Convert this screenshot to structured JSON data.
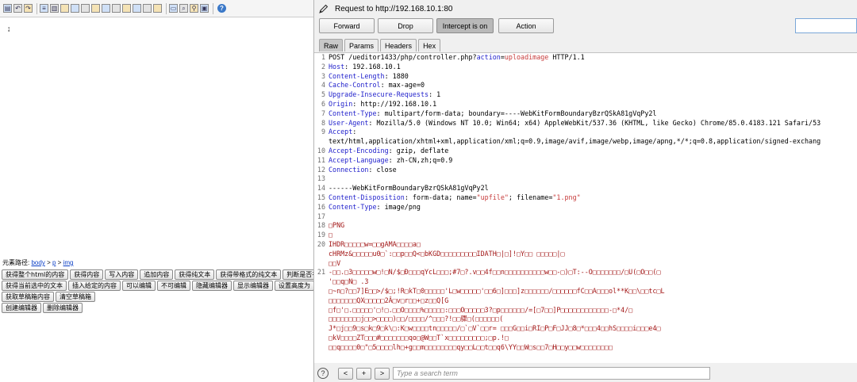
{
  "editor_toolbar": {
    "icons": [
      "source-icon",
      "undo-icon",
      "redo-icon",
      "format-icon",
      "paste-icon",
      "table-icon",
      "insert-table-icon",
      "delete-table-icon",
      "row-insert-icon",
      "row-delete-icon",
      "col-insert-icon",
      "col-delete-icon",
      "merge-cells-icon",
      "split-cells-icon",
      "insert-paragraph-icon",
      "print-icon",
      "preview-icon",
      "search-replace-icon",
      "drafts-icon",
      "help-icon"
    ]
  },
  "element_path": {
    "label": "元素路径:",
    "items": [
      "body",
      "p",
      "img"
    ],
    "separator": ">"
  },
  "editor_buttons": {
    "row1": [
      "获得整个html的内容",
      "获得内容",
      "写入内容",
      "追加内容",
      "获得纯文本",
      "获得带格式的纯文本",
      "判断是否有"
    ],
    "row2": [
      "获得当前选中的文本",
      "插入给定的内容",
      "可以编辑",
      "不可编辑",
      "隐藏编辑器",
      "显示编辑器",
      "设置高度为"
    ],
    "row3": [
      "获取草稿箱内容",
      "清空草稿箱"
    ],
    "row4": [
      "创建编辑器",
      "删除编辑器"
    ]
  },
  "burp": {
    "request_label": "Request to http://192.168.10.1:80",
    "buttons": {
      "forward": "Forward",
      "drop": "Drop",
      "intercept": "Intercept is on",
      "action": "Action"
    },
    "tabs": [
      "Raw",
      "Params",
      "Headers",
      "Hex"
    ],
    "active_tab": "Raw",
    "search_placeholder": "Type a search term",
    "nav": {
      "prev": "<",
      "add": "+",
      "next": ">"
    },
    "help": "?"
  },
  "request_lines": [
    {
      "n": "1",
      "parts": [
        {
          "t": "POST /ueditor1433/php/controller.php?",
          "c": "v"
        },
        {
          "t": "action",
          "c": "k"
        },
        {
          "t": "=",
          "c": "v"
        },
        {
          "t": "uploadimage",
          "c": "p"
        },
        {
          "t": " HTTP/1.1",
          "c": "v"
        }
      ]
    },
    {
      "n": "2",
      "parts": [
        {
          "t": "Host",
          "c": "k"
        },
        {
          "t": ": 192.168.10.1",
          "c": "v"
        }
      ]
    },
    {
      "n": "3",
      "parts": [
        {
          "t": "Content-Length",
          "c": "k"
        },
        {
          "t": ": 1880",
          "c": "v"
        }
      ]
    },
    {
      "n": "4",
      "parts": [
        {
          "t": "Cache-Control",
          "c": "k"
        },
        {
          "t": ": max-age=0",
          "c": "v"
        }
      ]
    },
    {
      "n": "5",
      "parts": [
        {
          "t": "Upgrade-Insecure-Requests",
          "c": "k"
        },
        {
          "t": ": 1",
          "c": "v"
        }
      ]
    },
    {
      "n": "6",
      "parts": [
        {
          "t": "Origin",
          "c": "k"
        },
        {
          "t": ": http://192.168.10.1",
          "c": "v"
        }
      ]
    },
    {
      "n": "7",
      "parts": [
        {
          "t": "Content-Type",
          "c": "k"
        },
        {
          "t": ": multipart/form-data; boundary=----WebKitFormBoundaryBzrQSkA81gVqPy2l",
          "c": "v"
        }
      ]
    },
    {
      "n": "8",
      "parts": [
        {
          "t": "User-Agent",
          "c": "k"
        },
        {
          "t": ": Mozilla/5.0 (Windows NT 10.0; Win64; x64) AppleWebKit/537.36 (KHTML, like Gecko) Chrome/85.0.4183.121 Safari/53",
          "c": "v"
        }
      ]
    },
    {
      "n": "9",
      "parts": [
        {
          "t": "Accept",
          "c": "k"
        },
        {
          "t": ":",
          "c": "v"
        }
      ]
    },
    {
      "n": "",
      "parts": [
        {
          "t": "text/html,application/xhtml+xml,application/xml;q=0.9,image/avif,image/webp,image/apng,*/*;q=0.8,application/signed-exchang",
          "c": "v"
        }
      ]
    },
    {
      "n": "10",
      "parts": [
        {
          "t": "Accept-Encoding",
          "c": "k"
        },
        {
          "t": ": gzip, deflate",
          "c": "v"
        }
      ]
    },
    {
      "n": "11",
      "parts": [
        {
          "t": "Accept-Language",
          "c": "k"
        },
        {
          "t": ": zh-CN,zh;q=0.9",
          "c": "v"
        }
      ]
    },
    {
      "n": "12",
      "parts": [
        {
          "t": "Connection",
          "c": "k"
        },
        {
          "t": ": close",
          "c": "v"
        }
      ]
    },
    {
      "n": "13",
      "parts": [
        {
          "t": "",
          "c": "v"
        }
      ]
    },
    {
      "n": "14",
      "parts": [
        {
          "t": "------WebKitFormBoundaryBzrQSkA81gVqPy2l",
          "c": "v"
        }
      ]
    },
    {
      "n": "15",
      "parts": [
        {
          "t": "Content-Disposition",
          "c": "k"
        },
        {
          "t": ": form-data; name=",
          "c": "v"
        },
        {
          "t": "\"upfile\"",
          "c": "p"
        },
        {
          "t": "; filename=",
          "c": "v"
        },
        {
          "t": "\"1.png\"",
          "c": "p"
        }
      ]
    },
    {
      "n": "16",
      "parts": [
        {
          "t": "Content-Type",
          "c": "k"
        },
        {
          "t": ": image/png",
          "c": "v"
        }
      ]
    },
    {
      "n": "17",
      "parts": [
        {
          "t": "",
          "c": "v"
        }
      ]
    },
    {
      "n": "18",
      "parts": [
        {
          "t": "□PNG",
          "c": "bin"
        }
      ]
    },
    {
      "n": "19",
      "parts": [
        {
          "t": "□",
          "c": "bin"
        }
      ]
    },
    {
      "n": "20",
      "parts": [
        {
          "t": "IHDR□□□□□w=□□gAMA□□□□a□",
          "c": "bin"
        }
      ]
    },
    {
      "n": "",
      "parts": [
        {
          "t": "cHRMz&□□□□□u0□`:□□p□□Q<□bKGD□□□□□□□□□IDATH□|□]!□Y□□ □□□□□|□",
          "c": "bin"
        }
      ]
    },
    {
      "n": "",
      "parts": [
        {
          "t": "□□V",
          "c": "bin"
        }
      ]
    },
    {
      "n": "21",
      "parts": [
        {
          "t": "-□□.□3□□□□□w□!□N/$□Ð□□□qYcL□□□;#7□?.v□□4f□□n□□□□□□□□□□w□□-□)□T:--O□□□□□□□/□U(□O□□(□",
          "c": "bin"
        }
      ]
    },
    {
      "n": "",
      "parts": [
        {
          "t": "'□□q□N□ .3",
          "c": "bin"
        }
      ]
    },
    {
      "n": "",
      "parts": [
        {
          "t": "□~n□?□□7]E□□>/$□;!R□kT□0□□□□□'L□w□□□□□'□□6□]□□□]z□□□□□□/□□□□□□fC□□A□□□ol**K□□\\□□tc□L",
          "c": "bin"
        }
      ]
    },
    {
      "n": "",
      "parts": [
        {
          "t": "□□□□□□□QX□□□□□2Â□v□r□□+□z□□Q[G",
          "c": "bin"
        }
      ]
    },
    {
      "n": "",
      "parts": [
        {
          "t": "□f□'□.□□□□□'□!□.□□O□□□□%□□□□□:□□□O□□□□□3?□p□□□□□□/=[□7□□]P□□□□□□□□□□□□-□*4/□",
          "c": "bin"
        }
      ]
    },
    {
      "n": "",
      "parts": [
        {
          "t": "□□□□□□□□j□□>□□□□)□□/□□□□/^□□□?!□□骤□(□□□□□□(",
          "c": "bin"
        }
      ]
    },
    {
      "n": "",
      "parts": [
        {
          "t": "J*□j□□9□s□k□9□k\\□:K□w□□□□tn□□□□□/□`□V`□□r= □□□G□□i□RI□P□F□JJ□8□*□□□4□□hS□□□□i□□□e4□",
          "c": "bin"
        }
      ]
    },
    {
      "n": "",
      "parts": [
        {
          "t": "□kV□□□□ZT□□□#□□□□□□□qo□@W□□T`x□□□□□□□□□;□p.!□",
          "c": "bin"
        }
      ]
    },
    {
      "n": "",
      "parts": [
        {
          "t": "□□q□□□□0□\"□5□□□□lh□+g□□m□□□□□□□□qy□□L□□t□□q6\\YY□□W□s□□7□H□□y□□w□□□□□□□□",
          "c": "bin"
        }
      ]
    }
  ]
}
